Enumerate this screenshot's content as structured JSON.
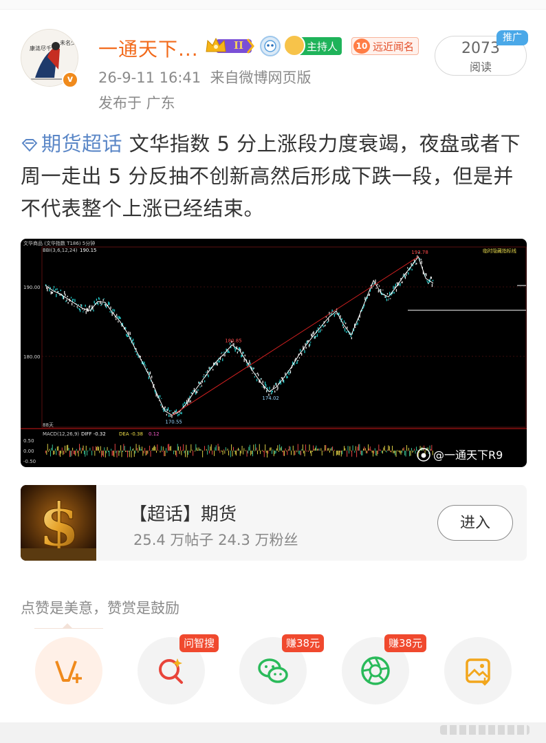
{
  "header": {
    "username": "一通天下...",
    "vip_badge": "II",
    "host_badge": "主持人",
    "fame_badge_level": "10",
    "fame_badge": "远近闻名",
    "meta_line": "26-9-11 16:41  来自微博网页版",
    "location_line": "发布于 广东",
    "read_count": "2073",
    "read_label": "阅读",
    "promo_label": "推广",
    "verified_color": "#f08a1c",
    "username_color": "#f26a1b"
  },
  "post": {
    "topic": "期货超话",
    "text": " 文华指数 5 分上涨段力度衰竭，夜盘或者下周一走出 5 分反抽不创新高然后形成下跌一段，但是并不代表整个上涨已经结束。",
    "topic_color": "#5b87c7"
  },
  "chart_image": {
    "header_left": "文华商品 (文华指数 T186)  5分钟",
    "header_right": "临时隐藏指标线",
    "bbi_label": "BBI(3,6,12,24)",
    "bbi_value": "190.15",
    "y_ticks": [
      "190.00",
      "180.00"
    ],
    "price_labels": [
      "193.78",
      "180.85",
      "174.02",
      "170.55"
    ],
    "bars_label": "88天",
    "macd_label": "MACD(12,26,9)",
    "macd_diff": "DIFF -0.32",
    "macd_dea": "DEA -0.38",
    "macd_value": "0.12",
    "macd_ticks": [
      "0.50",
      "0.00",
      "-0.50"
    ],
    "watermark": "@一通天下R9"
  },
  "chart_data": {
    "type": "line",
    "title": "",
    "series": [
      {
        "values": [
          189.6,
          188.8,
          188.3,
          187.6,
          186.9,
          186.2,
          185.9,
          187.2,
          187.1,
          185.6,
          184.3,
          182.6,
          180.4,
          178.3,
          176.2,
          173.6,
          171.2,
          170.55,
          171.1,
          172.4,
          174.1,
          175.6,
          177.1,
          178.5,
          179.6,
          180.85,
          180.1,
          178.4,
          176.7,
          175.2,
          174.02,
          174.7,
          176.1,
          177.6,
          179.4,
          180.9,
          182.3,
          183.6,
          184.9,
          185.8,
          183.8,
          182.3,
          184.9,
          187.6,
          190.3,
          188.4,
          187.9,
          189.3,
          190.9,
          192.3,
          193.78,
          190.6,
          189.9
        ]
      }
    ],
    "ylim": [
      169,
      195
    ],
    "annotations": [
      "193.78",
      "180.85",
      "174.02",
      "170.55"
    ]
  },
  "card": {
    "title": "【超话】期货",
    "subtitle": "25.4 万帖子 24.3 万粉丝",
    "button": "进入"
  },
  "praise_text": "点赞是美意，赞赏是鼓励",
  "actions": [
    {
      "icon": "reward-v-icon",
      "tag": ""
    },
    {
      "icon": "ai-search-icon",
      "tag": "问智搜"
    },
    {
      "icon": "wechat-icon",
      "tag": "赚38元"
    },
    {
      "icon": "moments-icon",
      "tag": "赚38元"
    },
    {
      "icon": "save-image-icon",
      "tag": ""
    }
  ],
  "colors": {
    "accent_orange": "#f26a1b",
    "tag_red": "#f0492e",
    "chart_bg": "#000000",
    "candle_up": "#e0e0e0",
    "candle_down": "#22c8c8"
  }
}
